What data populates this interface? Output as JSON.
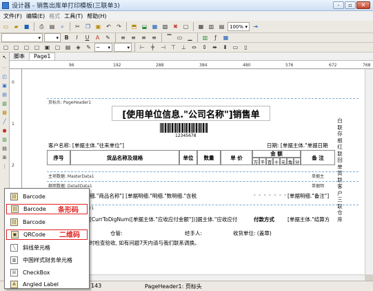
{
  "window": {
    "title": "设计器 - 销售出库单打印模板(三联单3)",
    "min": "-",
    "max": "▫",
    "close": "✕"
  },
  "menu": [
    "文件(F)",
    "编辑(E)",
    "格式",
    "工具(T)",
    "帮助(H)"
  ],
  "toolbar2": {
    "font_value": "",
    "size_value": "",
    "bold": "B",
    "italic": "I",
    "underline": "U"
  },
  "toolbar1": {
    "zoom": "100%"
  },
  "tabs": {
    "script": "脚本",
    "page": "Page1"
  },
  "ruler": {
    "h_ticks": [
      "96",
      "192",
      "288",
      "384",
      "480",
      "576",
      "672",
      "768"
    ],
    "v_ticks": [
      "0",
      "1",
      "2",
      "3",
      "4"
    ]
  },
  "report": {
    "page_header_band": "页标头: PageHeader1",
    "title": "[使用单位信息.\"公司名称\"]销售单",
    "barcode_number": "12345678",
    "customer": "客户名称: [单据主体.\"往来单位\"]",
    "date": "日期: [单据主体.\"单据日期",
    "col_no": "序号",
    "col_name": "货品名称及规格",
    "col_unit": "单位",
    "col_qty": "数量",
    "col_price": "单 价",
    "col_amount": "金 额",
    "col_amount_digits": [
      "万",
      "千",
      "百",
      "十",
      "元",
      "角",
      "分"
    ],
    "col_note": "备 注",
    "master_band": "主项数据: MasterData1",
    "master_band_right": "单据主",
    "detail_band": "细项数据: DetailData1",
    "detail_band_right": "单据明",
    "detail_row": "细.\"商品名称\"] [单据明细.\"明细.\"数明细.\"含税",
    "detail_row_note": "[单据明细.\"备注\"]",
    "footer_band": "r1",
    "footer_row": "[CurrToDigNum([单据主体.\"应收应付金额\"])]据主体.\"应收应付",
    "pay_label": "付款方式",
    "pay_value": "[单据主体.\"结算方",
    "keeper": "仓管:",
    "handler": "经手人:",
    "receiver": "收货单位: (盖章)",
    "notice": "时检查验收, 如有问题7天内请与我们联系调换。",
    "side_labels": "白联存根 红联回单 黄联客户 三联仓库"
  },
  "popup": {
    "items": [
      {
        "label": "Barcode",
        "icon": "barcode-icon"
      },
      {
        "label": "Barcode",
        "icon": "barcode-icon"
      },
      {
        "label": "Barcode",
        "icon": "barcode-icon"
      },
      {
        "label": "QRCode",
        "icon": "qrcode-icon"
      },
      {
        "label": "斜线单元格",
        "icon": "diagonal-cell-icon"
      },
      {
        "label": "中国样式财务单元格",
        "icon": "finance-cell-icon"
      },
      {
        "label": "CheckBox",
        "icon": "checkbox-icon"
      },
      {
        "label": "Angled Label",
        "icon": "angled-label-icon"
      }
    ],
    "annotation_barcode": "条形码",
    "annotation_qrcode": "二维码"
  },
  "status": {
    "coords": "143",
    "selection": "PageHeader1: 页标头"
  },
  "colors": {
    "highlight": "#e02020",
    "band_line": "#7aa7d6"
  }
}
